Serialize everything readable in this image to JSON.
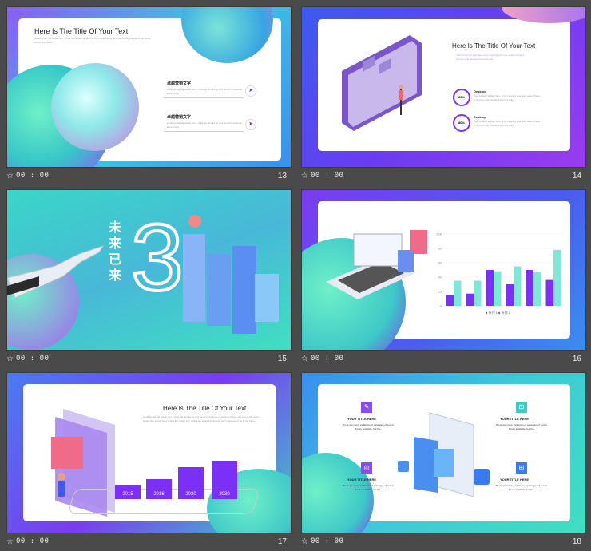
{
  "slides": [
    {
      "number": "13",
      "time": "00 : 00",
      "title": "Here Is The Title Of Your Text",
      "body": "Looking into the outset sun, I think we should go and we don't suppose of us to get there, the eye of the curve where she stood.",
      "items": [
        {
          "heading": "卓越营销文字",
          "text": "Looking into the outset sun, I think we should go and we don't suppose, keep trying."
        },
        {
          "heading": "卓越营销文字",
          "text": "Looking into the outset sun, I think we should go and we don't suppose, keep trying."
        }
      ]
    },
    {
      "number": "14",
      "time": "00 : 00",
      "title": "Here Is The Title Of Your Text",
      "body": "Your content to play here or by copying your text, select Paste in this box and choose Keep text only.",
      "stats": [
        {
          "percent": "60%",
          "label": "Desktop",
          "text": "Your content to play here, or by copying your text, select Paste in this box and choose Keep text only."
        },
        {
          "percent": "80%",
          "label": "Desktop",
          "text": "Your content to play here, or by copying your text, select Paste in this box and choose Keep text only."
        }
      ]
    },
    {
      "number": "15",
      "time": "00 : 00",
      "chars": [
        "未",
        "来",
        "已",
        "来"
      ],
      "big_digit": "3"
    },
    {
      "number": "16",
      "time": "00 : 00",
      "legend": "■ 系列 1  ■ 系列 2",
      "yticks": [
        "100",
        "80",
        "60",
        "40",
        "20",
        "0"
      ]
    },
    {
      "number": "17",
      "time": "00 : 00",
      "title": "Here Is The Title Of Your Text",
      "body": "Looking into the outset sun, I think we should go and we don't suppose of us to get there, the eye of the curve where she stood. Keep trying the outset sun, I think we should go and we don't suppose of us to get there."
    },
    {
      "number": "18",
      "time": "00 : 00",
      "items": [
        {
          "heading": "YOUR TITLE HERE",
          "text": "There are many variations of passages of Lorem Ipsum available, but the."
        },
        {
          "heading": "YOUR TITLE HERE",
          "text": "There are many variations of passages of Lorem Ipsum available, but the."
        },
        {
          "heading": "YOUR TITLE HERE",
          "text": "There are many variations of passages of Lorem Ipsum available, but the."
        },
        {
          "heading": "YOUR TITLE HERE",
          "text": "There are many variations of passages of Lorem Ipsum available, but the."
        }
      ]
    }
  ],
  "chart_data": {
    "type": "bar",
    "categories": [
      "1",
      "2",
      "3",
      "4",
      "5",
      "6"
    ],
    "series": [
      {
        "values": [
          15,
          17,
          50,
          30,
          50,
          36
        ]
      },
      {
        "values": [
          35,
          35,
          48,
          55,
          47,
          78
        ]
      }
    ],
    "ylim": [
      0,
      100
    ]
  },
  "timeline_years": [
    "2015",
    "2016",
    "2020",
    "2030"
  ],
  "colors": {
    "purple": "#7b2ff7",
    "teal": "#3ee0c8",
    "blue": "#4c7df0",
    "mint": "#7de8d8"
  },
  "star_icon": "☆"
}
